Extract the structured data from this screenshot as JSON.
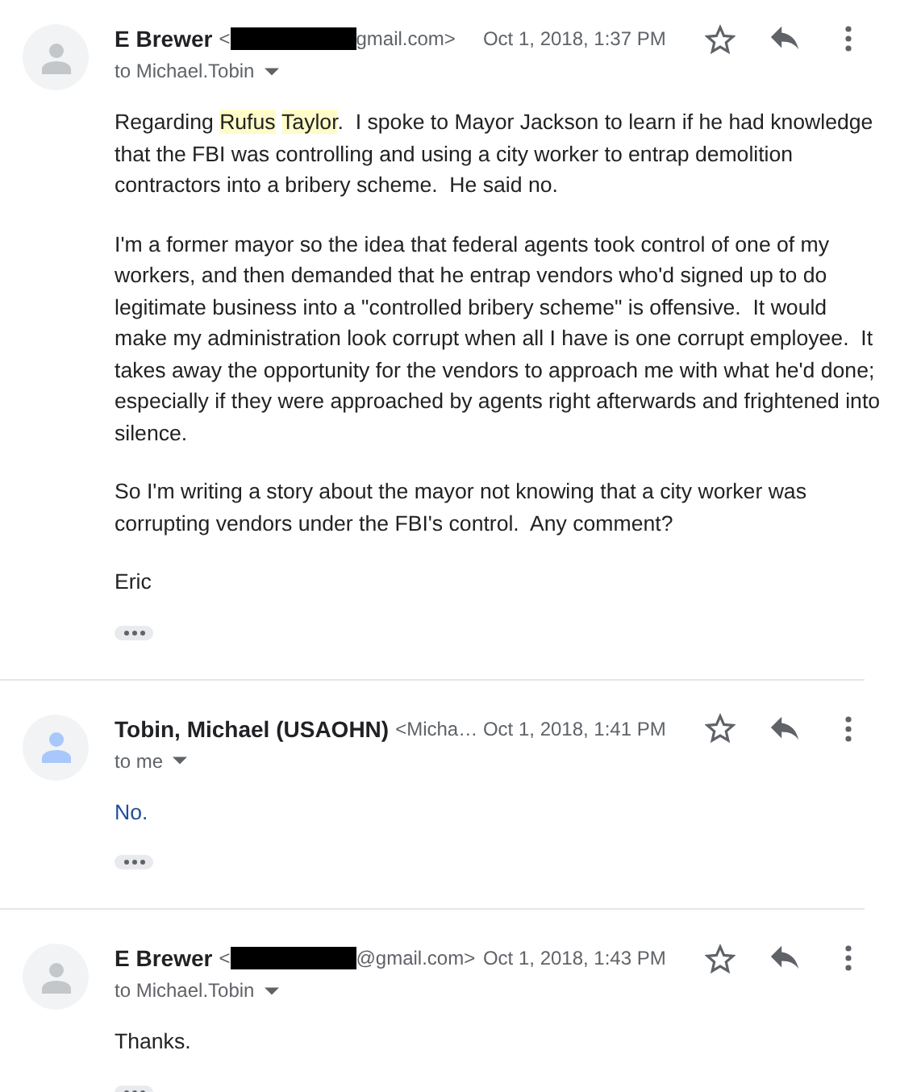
{
  "messages": [
    {
      "sender": "E Brewer",
      "email": {
        "before": "<",
        "redacted": true,
        "after": "gmail.com>"
      },
      "date": "Oct 1, 2018, 1:37 PM",
      "recipients": "to Michael.Tobin",
      "avatar": {
        "color": "#c4c7c9"
      },
      "body": {
        "color": "#222222",
        "paragraphs": [
          [
            {
              "text": "Regarding "
            },
            {
              "text": "Rufus",
              "highlighted": true
            },
            {
              "text": "Taylor",
              "highlighted": true
            },
            {
              "text": ".  I spoke to Mayor Jackson to learn if he had knowledge that the FBI was controlling and using a city worker to entrap demolition contractors into a bribery scheme.  He said no."
            }
          ],
          [
            {
              "text": "I'm a former mayor so the idea that federal agents took control of one of my workers, and then demanded that he entrap vendors who'd signed up to do legitimate business into a \"controlled bribery scheme\" is offensive.  It would make my administration look corrupt when all I have is one corrupt employee.  It takes away the opportunity for the vendors to approach me with what he'd done; especially if they were approached by agents right afterwards and frightened into silence."
            }
          ],
          [
            {
              "text": "So I'm writing a story about the mayor not knowing that a city worker was corrupting vendors under the FBI's control.  Any comment?"
            }
          ],
          [
            {
              "text": "Eric"
            }
          ]
        ]
      }
    },
    {
      "sender": "Tobin, Michael (USAOHN)",
      "email": {
        "before": "<Micha…"
      },
      "date": "Oct 1, 2018, 1:41 PM",
      "recipients": "to me",
      "avatar": {
        "color": "#a8c7fa"
      },
      "body": {
        "color": "#1f4e99",
        "paragraphs": [
          [
            {
              "text": "No."
            }
          ]
        ]
      }
    },
    {
      "sender": "E Brewer",
      "email": {
        "before": "<",
        "redacted": true,
        "after": "@gmail.com>"
      },
      "date": "Oct 1, 2018, 1:43 PM",
      "recipients": "to Michael.Tobin",
      "avatar": {
        "color": "#c4c7c9"
      },
      "body": {
        "color": "#222222",
        "paragraphs": [
          [
            {
              "text": "Thanks."
            }
          ]
        ]
      }
    }
  ]
}
